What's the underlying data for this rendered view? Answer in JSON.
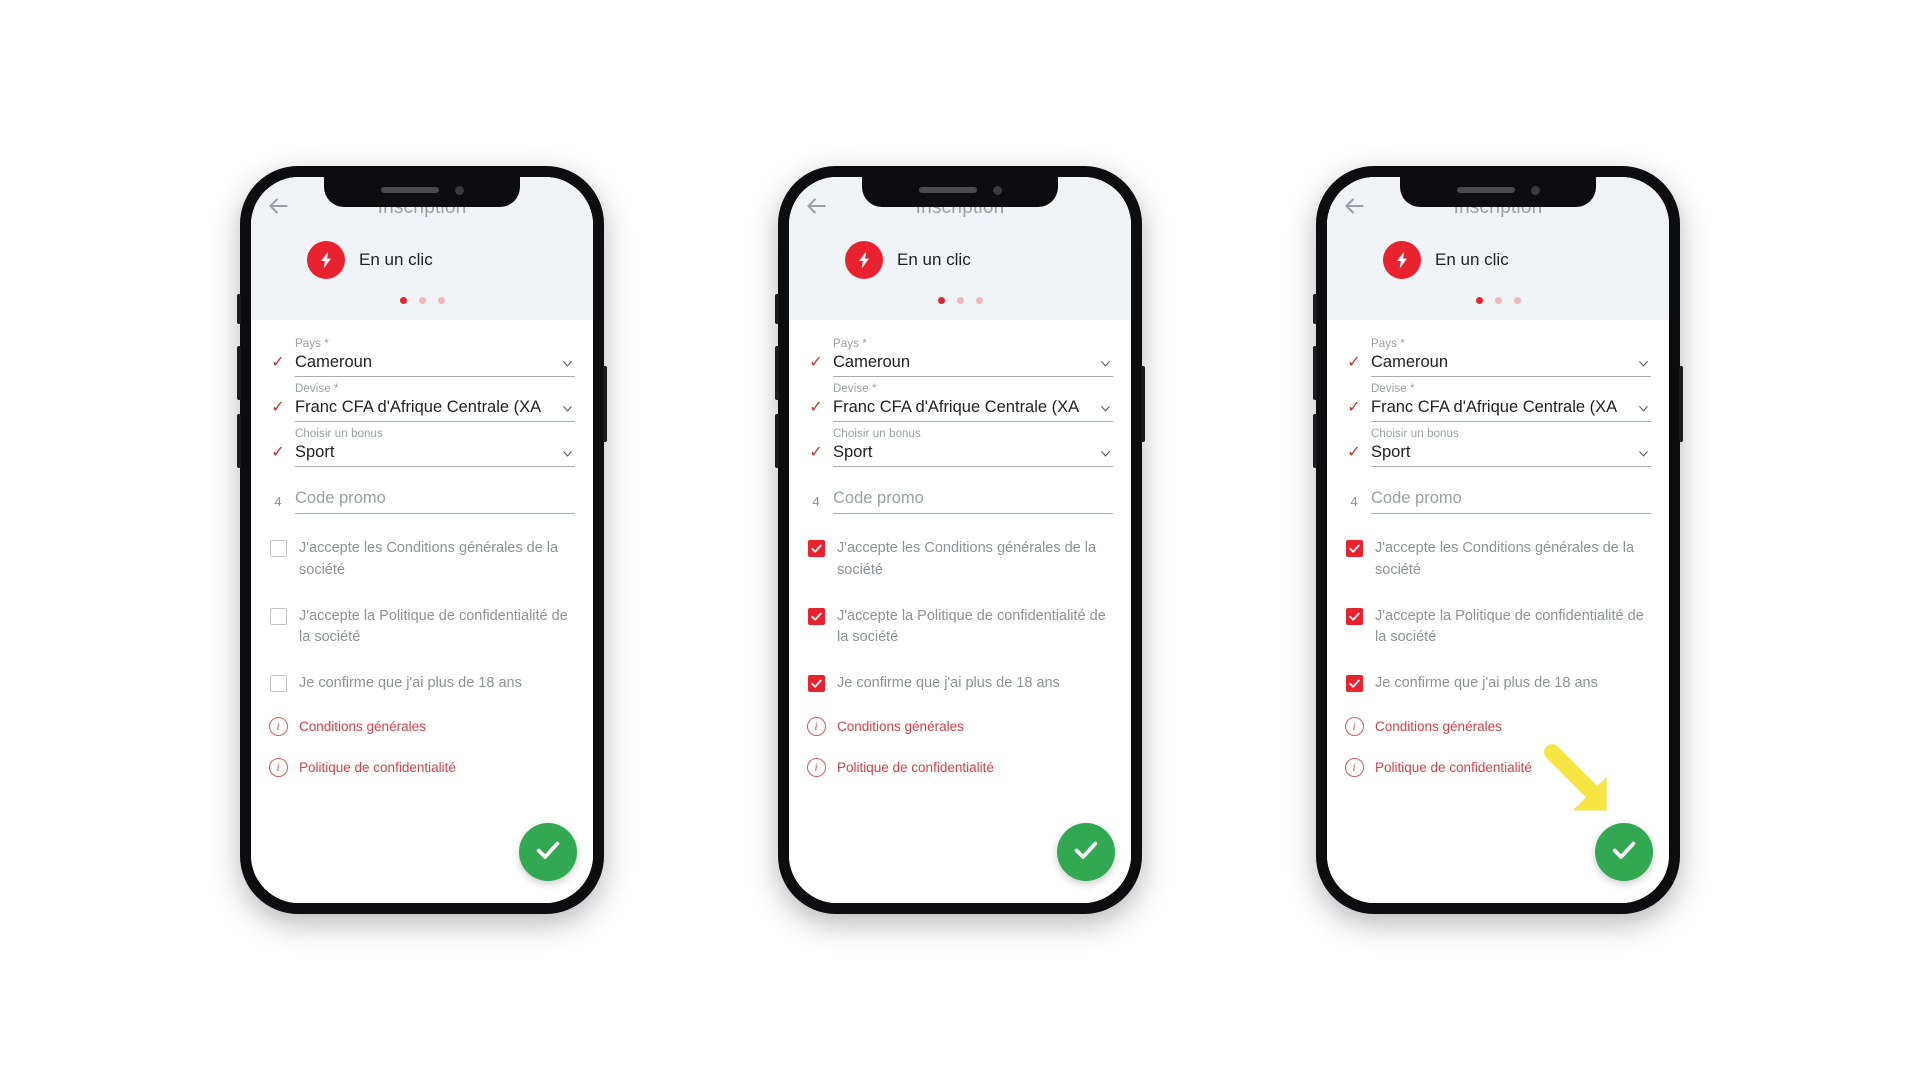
{
  "app": {
    "header_title": "Inscription",
    "brand_label": "En un clic",
    "back_icon": "back-arrow-icon",
    "bolt_icon": "bolt-icon",
    "pager": {
      "total": 3,
      "active_index": 0
    }
  },
  "colors": {
    "brand_red": "#e8232f",
    "link_red": "#d2414e",
    "fab_green": "#32a852",
    "header_bg": "#f0f4f6",
    "label_grey": "#9aa0a6",
    "arrow_yellow": "#f5e642"
  },
  "form": {
    "fields": [
      {
        "lead": "✓",
        "lead_kind": "tick",
        "label": "Pays *",
        "value": "Cameroun",
        "is_placeholder": false,
        "has_chevron": true
      },
      {
        "lead": "✓",
        "lead_kind": "tick",
        "label": "Devise *",
        "value": "Franc CFA d'Afrique Centrale (XΑ",
        "is_placeholder": false,
        "has_chevron": true
      },
      {
        "lead": "✓",
        "lead_kind": "tick",
        "label": "Choisir un bonus",
        "value": "Sport",
        "is_placeholder": false,
        "has_chevron": true
      },
      {
        "lead": "4",
        "lead_kind": "num",
        "label": "",
        "value": "Code promo",
        "is_placeholder": true,
        "has_chevron": false
      }
    ],
    "checkboxes": [
      {
        "label": "J'accepte les Conditions générales de la société"
      },
      {
        "label": "J'accepte la Politique de confidentialité de la société"
      },
      {
        "label": "Je confirme que j'ai plus de 18 ans"
      }
    ],
    "links": [
      {
        "icon": "info-icon",
        "label": "Conditions générales"
      },
      {
        "icon": "info-icon",
        "label": "Politique de confidentialité"
      }
    ],
    "submit_fab": {
      "icon": "check-icon",
      "label": ""
    }
  },
  "phones": [
    {
      "id": "phone-1",
      "checkboxes_checked": [
        false,
        false,
        false
      ],
      "show_arrow": false
    },
    {
      "id": "phone-2",
      "checkboxes_checked": [
        true,
        true,
        true
      ],
      "show_arrow": false
    },
    {
      "id": "phone-3",
      "checkboxes_checked": [
        true,
        true,
        true
      ],
      "show_arrow": true
    }
  ]
}
